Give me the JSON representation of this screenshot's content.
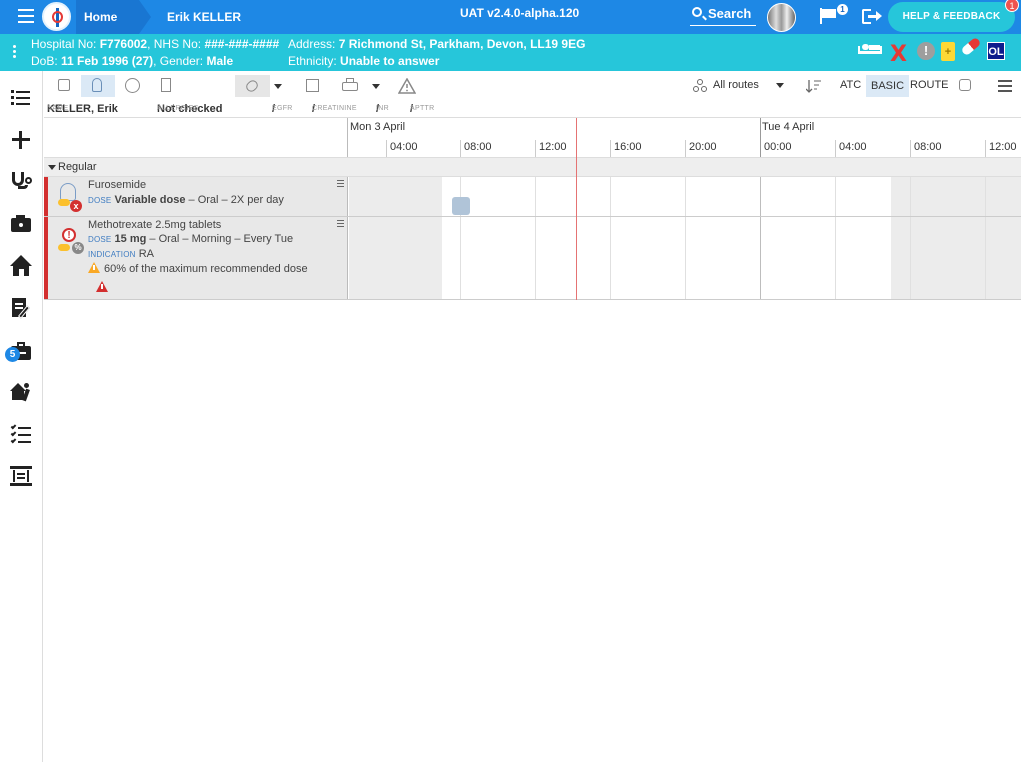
{
  "topbar": {
    "home_label": "Home",
    "patient_label": "Erik KELLER",
    "version": "UAT v2.4.0-alpha.120",
    "search_label": "Search",
    "flag_count": "1",
    "help_label": "HELP & FEEDBACK",
    "help_badge": "1"
  },
  "banner": {
    "hospital_no_label": "Hospital No:",
    "hospital_no": "F776002",
    "nhs_no_label": "NHS No:",
    "nhs_no": "###-###-####",
    "address_label": "Address:",
    "address": "7 Richmond St, Parkham, Devon, LL19 9EG",
    "dob_label": "DoB:",
    "dob": "11 Feb 1996 (27)",
    "gender_label": "Gender:",
    "gender": "Male",
    "ethnicity_label": "Ethnicity:",
    "ethnicity": "Unable to answer",
    "icons": [
      "bed-icon",
      "x-icon",
      "alert-icon",
      "clipboard-icon",
      "pill-icon",
      "ol-icon"
    ],
    "ol_label": "OL",
    "x_glyph": "X",
    "alert_glyph": "!",
    "clip_glyph": "+"
  },
  "leftnav": {
    "badge": "5",
    "items": [
      "list-icon",
      "plus-icon",
      "stethoscope-icon",
      "camera-icon",
      "home-icon",
      "document-edit-icon",
      "briefcase-icon",
      "exit-icon",
      "checklist-icon",
      "board-icon"
    ]
  },
  "toolbar": {
    "routes_label": "All routes",
    "atc_label": "ATC",
    "basic_label": "BASIC",
    "route_label": "ROUTE"
  },
  "info": {
    "name_key": "NAME",
    "name_value": "KELLER, Erik",
    "allergies_key": "ALLERGIES",
    "allergies_value": "Not checked",
    "egfr_key": "EGFR",
    "egfr_value": "/",
    "creatinine_key": "CREATININE",
    "creatinine_value": "/",
    "inr_key": "INR",
    "inr_value": "/",
    "apttr_key": "APTTR",
    "apttr_value": "/"
  },
  "timeline": {
    "day1": "Mon 3 April",
    "day2": "Tue 4 April",
    "ticks": [
      "04:00",
      "08:00",
      "12:00",
      "16:00",
      "20:00",
      "00:00",
      "04:00",
      "08:00",
      "12:00"
    ]
  },
  "group": {
    "label": "Regular"
  },
  "meds": [
    {
      "name": "Furosemide",
      "dose_label": "DOSE",
      "dose": "Variable dose",
      "dose_rest": " – Oral – 2X per day",
      "x_glyph": "x"
    },
    {
      "name": "Methotrexate 2.5mg tablets",
      "dose_label": "DOSE",
      "dose": "15 mg",
      "dose_rest": " – Oral – Morning – Every Tue",
      "indication_label": "INDICATION",
      "indication": "RA",
      "warning": "60% of the maximum recommended dose",
      "ex_glyph": "!",
      "pc_glyph": "%"
    }
  ],
  "colors": {
    "topbar": "#1e88e5",
    "banner": "#26c6da",
    "row_accent": "#d32f2f",
    "now_line": "#e57373"
  }
}
